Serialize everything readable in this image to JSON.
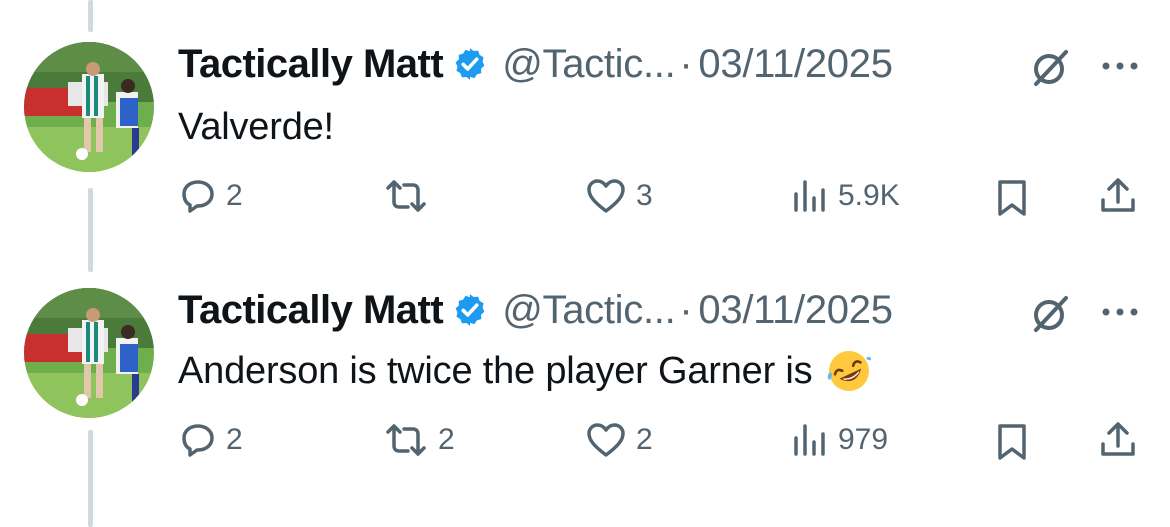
{
  "tweets": [
    {
      "author_name": "Tactically Matt",
      "handle": "@Tactic...",
      "separator": "·",
      "date": "03/11/2025",
      "text": "Valverde!",
      "emoji": "",
      "replies": "2",
      "reposts": "",
      "likes": "3",
      "views": "5.9K"
    },
    {
      "author_name": "Tactically Matt",
      "handle": "@Tactic...",
      "separator": "·",
      "date": "03/11/2025",
      "text": "Anderson is twice the player Garner is",
      "emoji": "rolling-on-floor-laughing",
      "replies": "2",
      "reposts": "2",
      "likes": "2",
      "views": "979"
    }
  ],
  "colors": {
    "text_primary": "#0f1419",
    "text_secondary": "#536471",
    "verified_blue": "#1d9bf0",
    "thread_line": "#cfd9de"
  },
  "icons": [
    "verified-badge-icon",
    "grok-icon",
    "more-icon",
    "reply-icon",
    "repost-icon",
    "like-icon",
    "views-icon",
    "bookmark-icon",
    "share-icon"
  ]
}
